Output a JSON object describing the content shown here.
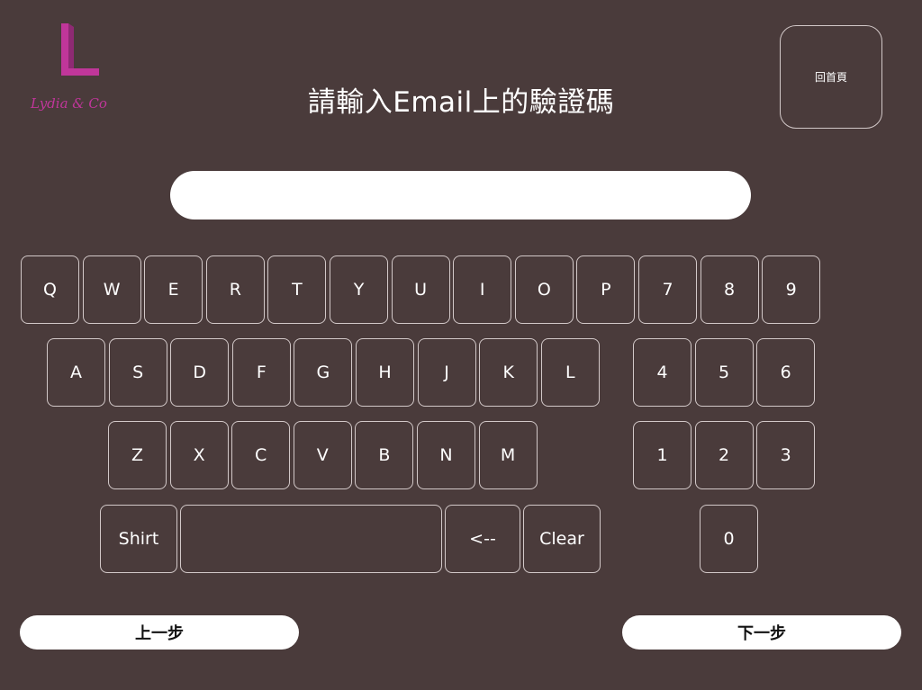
{
  "brand": {
    "logo_letter": "L",
    "logo_script": "Lydia & Co",
    "accent_color": "#c0369a"
  },
  "header": {
    "title": "請輸入Email上的驗證碼",
    "home_label": "回首頁"
  },
  "input": {
    "value": ""
  },
  "keyboard": {
    "row1": [
      "Q",
      "W",
      "E",
      "R",
      "T",
      "Y",
      "U",
      "I",
      "O",
      "P"
    ],
    "row2": [
      "A",
      "S",
      "D",
      "F",
      "G",
      "H",
      "J",
      "K",
      "L"
    ],
    "row3": [
      "Z",
      "X",
      "C",
      "V",
      "B",
      "N",
      "M"
    ],
    "shift_label": "Shirt",
    "space_label": "",
    "backspace_label": "<--",
    "clear_label": "Clear",
    "numpad": [
      "7",
      "8",
      "9",
      "4",
      "5",
      "6",
      "1",
      "2",
      "3",
      "0"
    ]
  },
  "nav": {
    "prev_label": "上一步",
    "next_label": "下一步"
  }
}
